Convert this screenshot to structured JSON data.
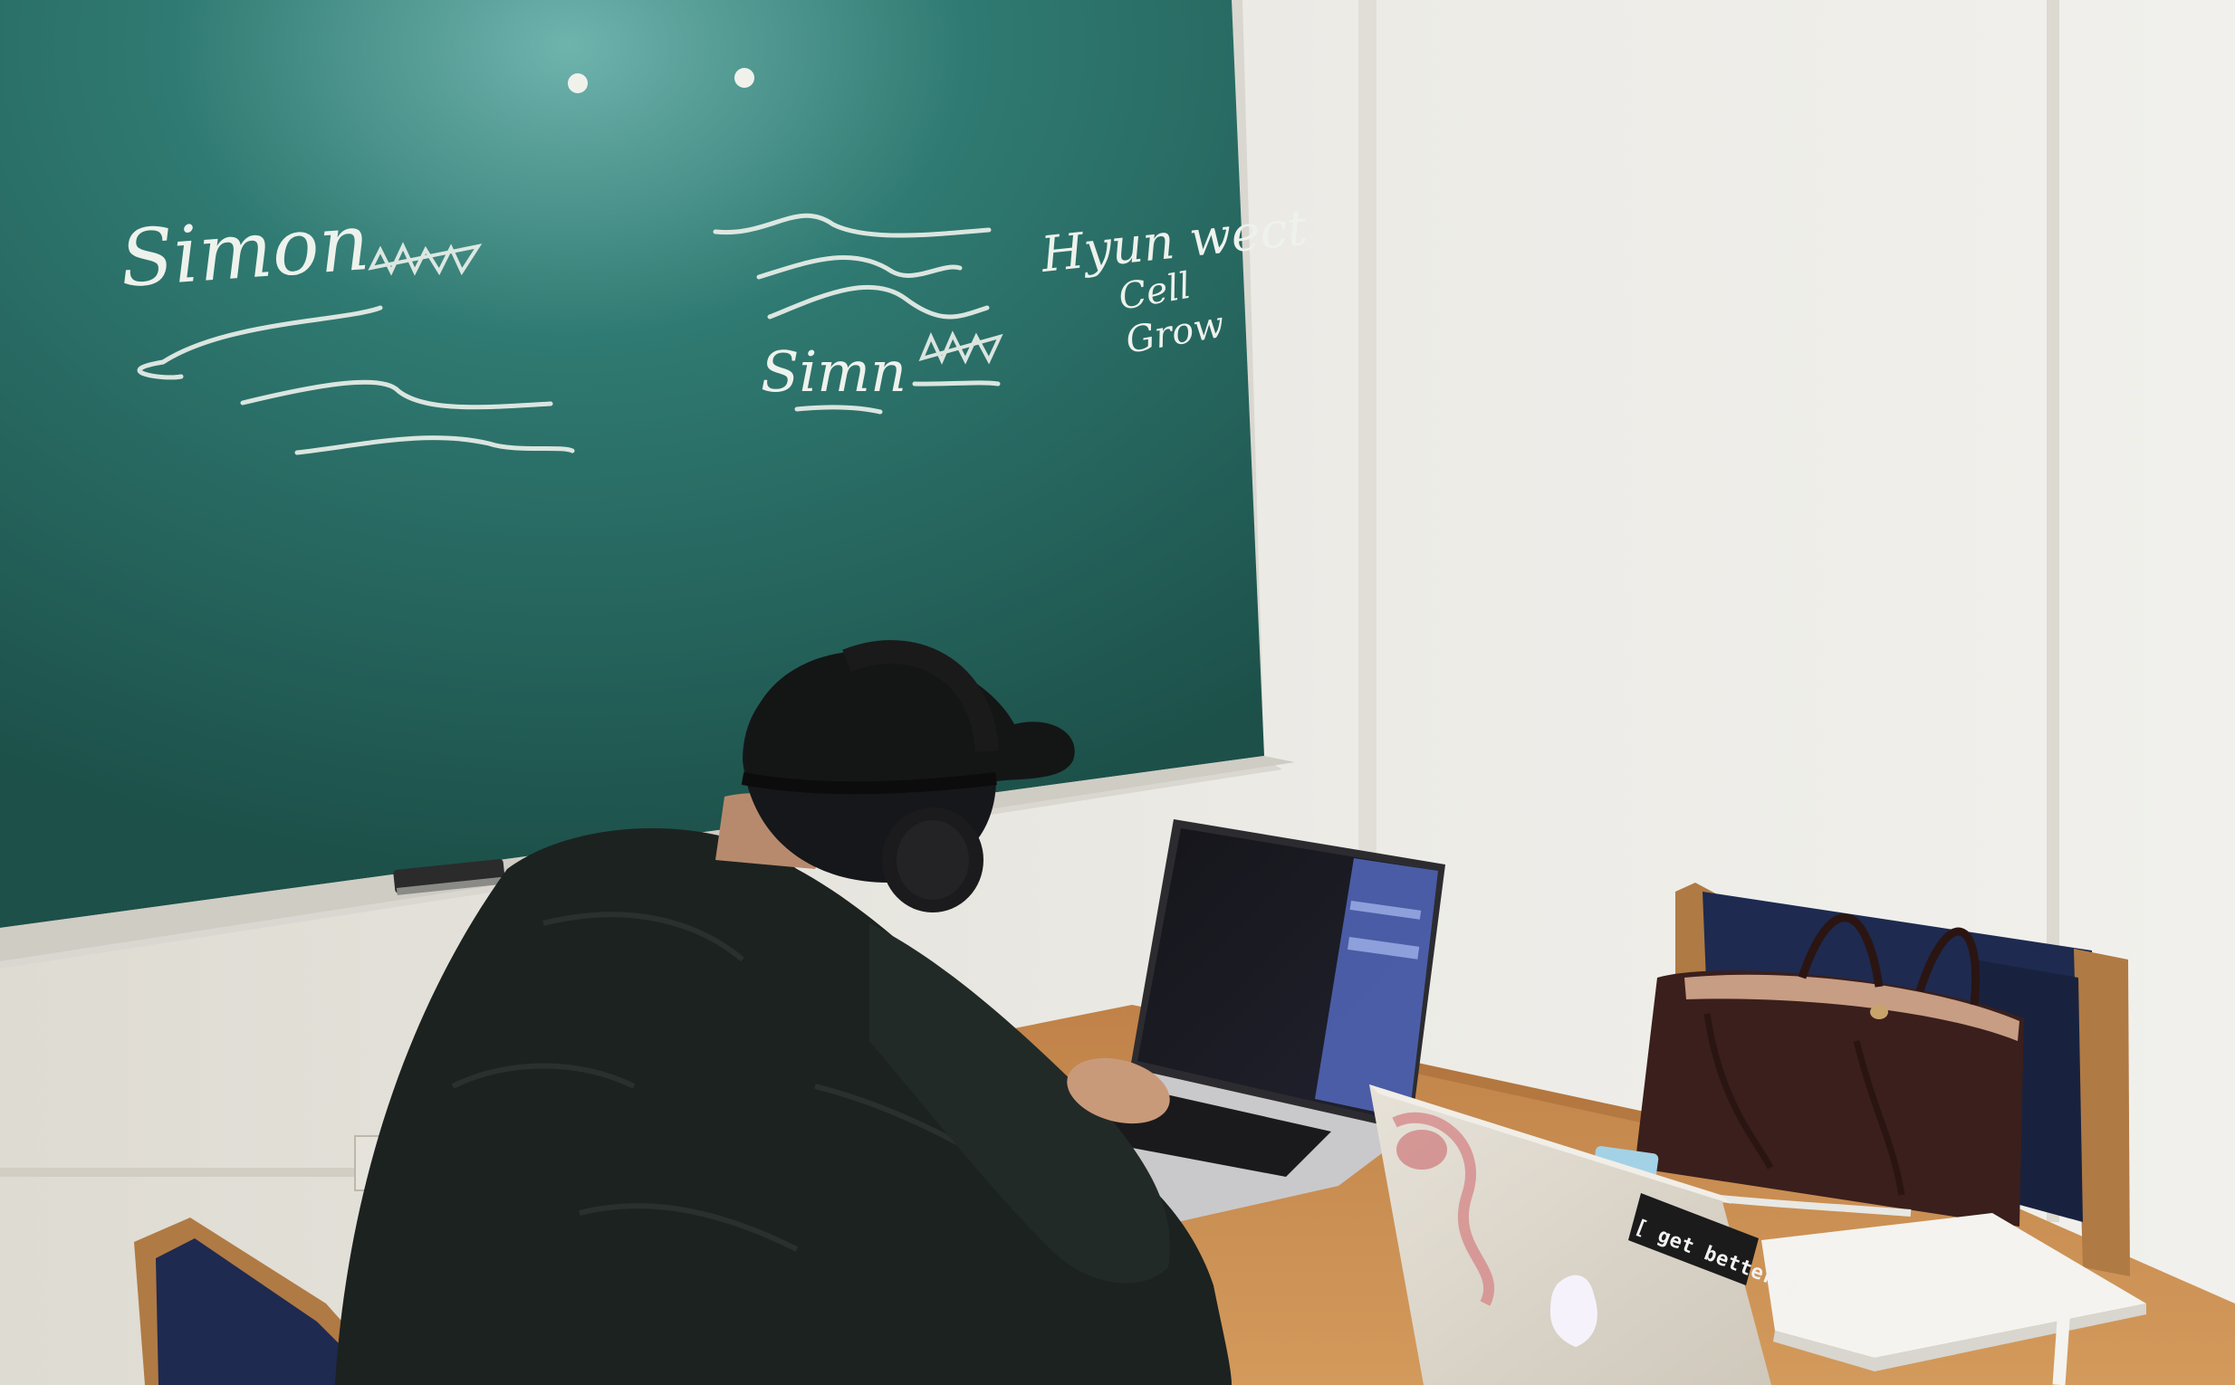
{
  "scene": {
    "description_free": true,
    "colors": {
      "chalkboard": "#1f5a52",
      "chalkboard_light": "#2f7a72",
      "wall": "#e9e7e1",
      "table": "#c98c4e",
      "hoodie": "#1c2220",
      "cap": "#141616",
      "chair_fabric": "#1e2a50",
      "chair_wood": "#b07a44",
      "bag": "#3a1f1c",
      "chalk": "#f0f3ee"
    }
  },
  "chalkboard": {
    "left_text": "Simon",
    "center_text": "Simn",
    "right_lines": [
      "Hyun wect",
      "Cell",
      "Grow"
    ]
  },
  "laptop_sticker": {
    "text": "[ get better ]"
  }
}
